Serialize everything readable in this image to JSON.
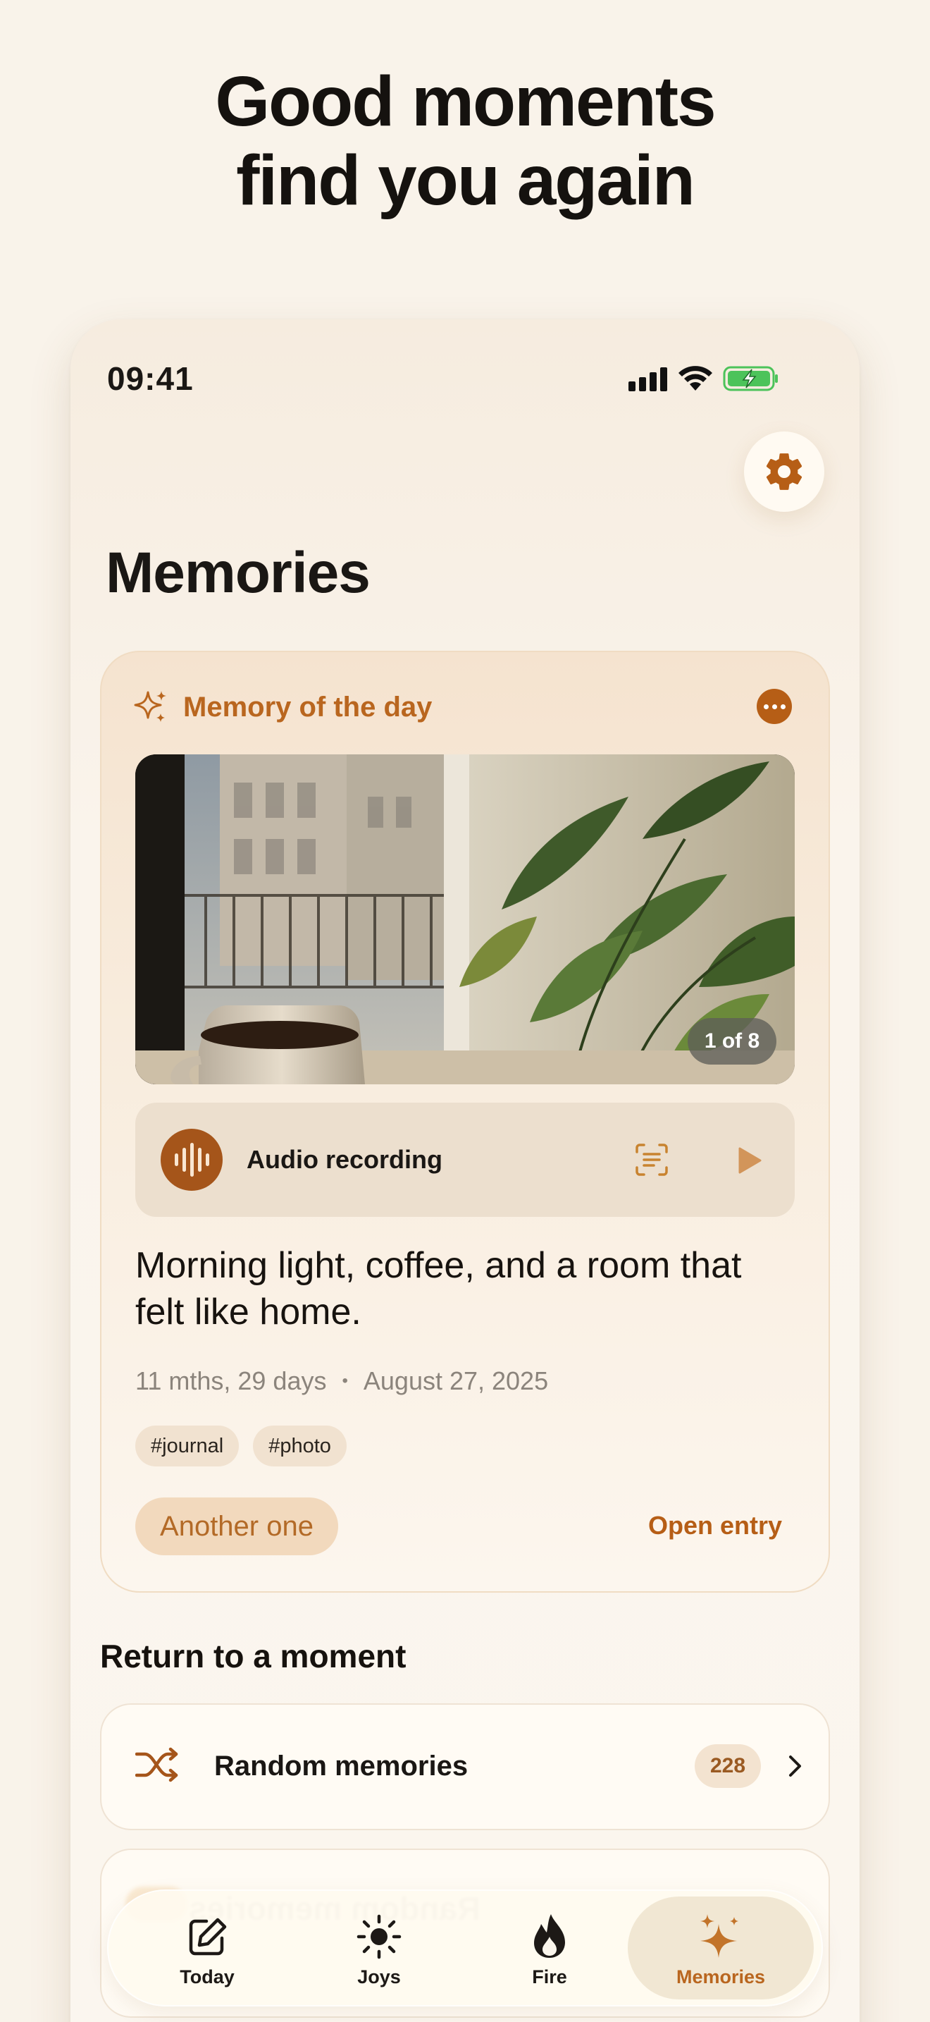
{
  "headline": {
    "line1": "Good moments",
    "line2": "find you again"
  },
  "status_bar": {
    "time": "09:41"
  },
  "page": {
    "title": "Memories"
  },
  "memory_card": {
    "label": "Memory of the day",
    "photo_counter": "1 of 8",
    "audio_label": "Audio recording",
    "entry_text": "Morning light, coffee, and a room that felt like home.",
    "elapsed": "11 mths, 29 days",
    "separator": "•",
    "date": "August 27, 2025",
    "tags": [
      "#journal",
      "#photo"
    ],
    "another_button": "Another one",
    "open_entry": "Open entry"
  },
  "section": {
    "title": "Return to a moment",
    "rows": [
      {
        "label": "Random memories",
        "count": "228"
      }
    ]
  },
  "tabbar": {
    "tabs": [
      {
        "label": "Today",
        "icon": "compose-icon"
      },
      {
        "label": "Joys",
        "icon": "sun-icon"
      },
      {
        "label": "Fire",
        "icon": "flame-icon"
      },
      {
        "label": "Memories",
        "icon": "sparkles-icon"
      }
    ],
    "active": "Memories"
  },
  "colors": {
    "background": "#f9f3ea",
    "accent": "#b65e16",
    "accent_light": "#f2d9bd",
    "text": "#1a1714",
    "muted": "#8b847c",
    "battery": "#4cc35a"
  }
}
